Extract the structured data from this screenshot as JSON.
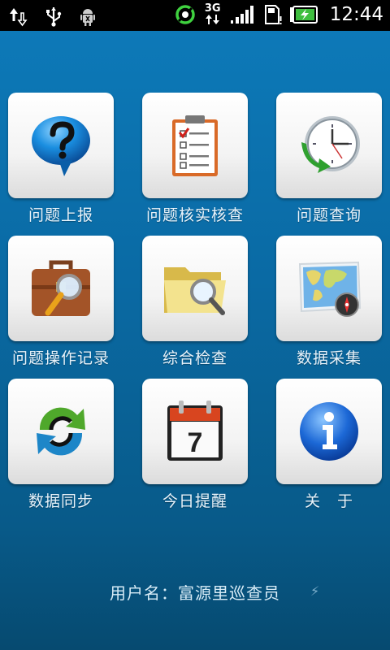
{
  "status_bar": {
    "time": "12:44",
    "network": "3G",
    "icons_left": [
      "data-transfer-icon",
      "usb-icon",
      "android-debug-icon"
    ],
    "icons_right": [
      "sync-icon",
      "network-3g-icon",
      "signal-icon",
      "sdcard-icon",
      "battery-charging-icon"
    ]
  },
  "menu": {
    "items": [
      {
        "label": "问题上报",
        "icon": "question-bubble-icon"
      },
      {
        "label": "问题核实核查",
        "icon": "checklist-clipboard-icon"
      },
      {
        "label": "问题查询",
        "icon": "clock-history-icon"
      },
      {
        "label": "问题操作记录",
        "icon": "briefcase-search-icon"
      },
      {
        "label": "综合检查",
        "icon": "folder-search-icon"
      },
      {
        "label": "数据采集",
        "icon": "map-compass-icon"
      },
      {
        "label": "数据同步",
        "icon": "sync-arrows-icon"
      },
      {
        "label": "今日提醒",
        "icon": "calendar-icon"
      },
      {
        "label": "关　于",
        "icon": "info-icon"
      }
    ]
  },
  "calendar_day": "7",
  "footer": {
    "user_text": "用户名：富源里巡查员"
  }
}
